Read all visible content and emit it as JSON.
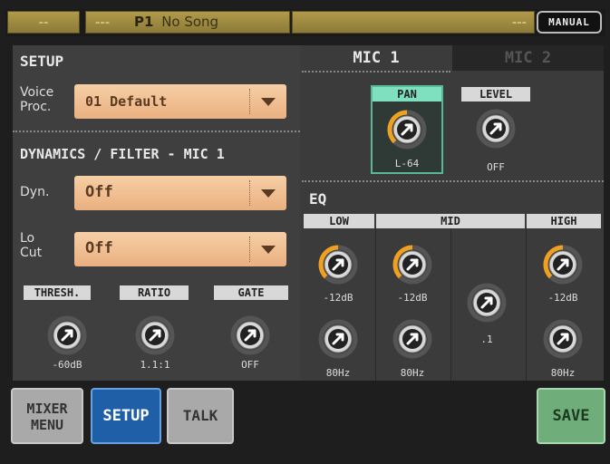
{
  "topbar": {
    "lcd1": "--",
    "lcd2": "---",
    "program": "P1",
    "song": "No Song",
    "lcd3": "---",
    "manual": "MANUAL"
  },
  "setup": {
    "title": "SETUP",
    "voice_label": "Voice\nProc.",
    "voice_value": "01 Default"
  },
  "dynamics": {
    "title": "DYNAMICS / FILTER - MIC 1",
    "dyn_label": "Dyn.",
    "dyn_value": "Off",
    "locut_label": "Lo\nCut",
    "locut_value": "Off",
    "knobs": [
      {
        "label": "THRESH.",
        "value": "-60dB"
      },
      {
        "label": "RATIO",
        "value": "1.1:1"
      },
      {
        "label": "GATE",
        "value": "OFF"
      }
    ]
  },
  "mic_tabs": [
    "MIC 1",
    "MIC 2"
  ],
  "pan": {
    "label": "PAN",
    "value": "L-64"
  },
  "level": {
    "label": "LEVEL",
    "value": "OFF"
  },
  "eq": {
    "title": "EQ",
    "bands": [
      "LOW",
      "MID",
      "HIGH"
    ],
    "low_gain": "-12dB",
    "low_freq": "80Hz",
    "mid_gain": "-12dB",
    "mid_freq": "80Hz",
    "mid_q": ".1",
    "high_gain": "-12dB",
    "high_freq": "80Hz"
  },
  "buttons": {
    "mixer_menu": "MIXER\nMENU",
    "setup": "SETUP",
    "talk": "TALK",
    "save": "SAVE"
  },
  "colors": {
    "accent_orange": "#f0a020",
    "dropdown": "#f2c497",
    "pan_highlight": "#57b89a",
    "setup_button": "#1f5fa8",
    "save_button": "#6fae7a"
  }
}
